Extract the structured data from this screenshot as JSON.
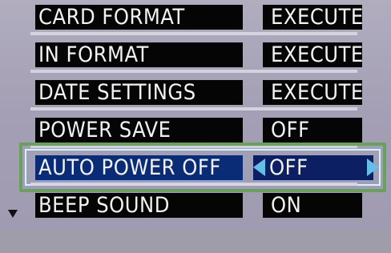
{
  "menu": {
    "items": [
      {
        "label": "CARD FORMAT",
        "value": "EXECUTE"
      },
      {
        "label": "IN FORMAT",
        "value": "EXECUTE"
      },
      {
        "label": "DATE SETTINGS",
        "value": "EXECUTE"
      },
      {
        "label": "POWER SAVE",
        "value": "OFF"
      },
      {
        "label": "AUTO POWER OFF",
        "value": "OFF",
        "selected": true
      },
      {
        "label": "BEEP SOUND",
        "value": "ON"
      }
    ]
  },
  "icons": {
    "selection_left": "left-arrow-icon",
    "selection_right": "right-arrow-icon",
    "scroll_more": "down-arrow-icon"
  },
  "colors": {
    "screen_background": "#a49fb4",
    "item_background": "#050505",
    "selected_background": "#0a2b76",
    "selection_frame": "#69a05b",
    "arrow_color": "#64bfe8"
  }
}
